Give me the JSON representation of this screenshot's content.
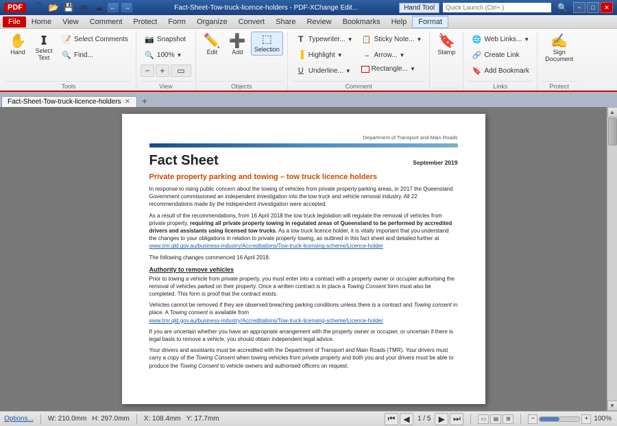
{
  "titlebar": {
    "title": "Fact-Sheet-Tow-truck-licence-holders - PDF-XChange Edit...",
    "tool": "Hand Tool",
    "search_placeholder": "Quick Launch (Ctrl+.)",
    "minimize": "−",
    "maximize": "□",
    "close": "✕"
  },
  "menubar": {
    "items": [
      "File",
      "Home",
      "View",
      "Comment",
      "Protect",
      "Form",
      "Organize",
      "Convert",
      "Share",
      "Review",
      "Bookmarks",
      "Help",
      "Format"
    ]
  },
  "ribbon": {
    "groups": [
      {
        "name": "Tools",
        "items_row1": [
          {
            "label": "Hand",
            "icon": "✋"
          },
          {
            "label": "Select\nText",
            "icon": "▌"
          },
          {
            "label": "Select\nComments",
            "icon": "📝"
          }
        ],
        "items_row2": [
          {
            "label": "Find...",
            "icon": "🔍"
          }
        ]
      },
      {
        "name": "View",
        "items": [
          {
            "label": "Snapshot",
            "icon": "📷"
          },
          {
            "label": "100%",
            "icon": ""
          },
          {
            "label": "View",
            "icon": ""
          }
        ]
      },
      {
        "name": "Objects",
        "items": [
          {
            "label": "Edit",
            "icon": "✏️"
          },
          {
            "label": "Add",
            "icon": "➕"
          },
          {
            "label": "Selection",
            "icon": "⬚"
          }
        ]
      },
      {
        "name": "Comment",
        "items": [
          {
            "label": "Typewriter...",
            "icon": "T"
          },
          {
            "label": "Highlight",
            "icon": "🖊"
          },
          {
            "label": "Underline...",
            "icon": "U"
          },
          {
            "label": "Sticky Note...",
            "icon": "📋"
          },
          {
            "label": "Arrow...",
            "icon": "→"
          },
          {
            "label": "Rectangle...",
            "icon": "□"
          }
        ]
      },
      {
        "name": "Stamp",
        "items": [
          {
            "label": "Stamp",
            "icon": "🔖"
          }
        ]
      },
      {
        "name": "Links",
        "items": [
          {
            "label": "Web Links...",
            "icon": "🔗"
          },
          {
            "label": "Create Link",
            "icon": "🔗"
          },
          {
            "label": "Add Bookmark",
            "icon": "🔖"
          }
        ]
      },
      {
        "name": "Protect",
        "items": [
          {
            "label": "Sign\nDocument",
            "icon": "🖊"
          }
        ]
      }
    ]
  },
  "doc_tab": {
    "name": "Fact-Sheet-Tow-truck-licence-holders",
    "close": "✕",
    "new_tab": "+"
  },
  "pdf": {
    "dept": "Department of Transport and Main Roads",
    "title": "Fact Sheet",
    "date": "September 2019",
    "subtitle": "Private property parking and towing – tow truck licence holders",
    "paragraphs": [
      "In response to rising public concern about the towing of vehicles from private property parking areas, in 2017 the Queensland Government commissioned an independent investigation into the tow truck and vehicle removal industry. All 22 recommendations made by the independent investigation were accepted.",
      "As a result of the recommendations, from 16 April 2018 the tow truck legislation will regulate the removal of vehicles from private property, requiring all private property towing in regulated areas of Queensland to be performed by accredited drivers and assistants using licensed tow trucks. As a tow truck licence holder, it is vitally important that you understand the changes to your obligations in relation to private property towing, as outlined in this fact sheet and detailed further at www.tmr.qld.gov.au/business-industry/Accreditations/Tow-truck-licensing-scheme/Licence-holder",
      "The following changes commenced 16 April 2018.",
      "Authority to remove vehicles",
      "Prior to towing a vehicle from private property, you must enter into a contract with a property owner or occupier authorising the removal of vehicles parked on their property. Once a written contract is in place a Towing Consent form must also be completed. This form is proof that the contract exists.",
      "Vehicles cannot be removed if they are observed breaching parking conditions unless there is a contract and Towing consent in place. A Towing consent is available from www.tmr.qld.gov.au/business-industry/Accreditations/Tow-truck-licensing-scheme/Licence-holder",
      "If you are uncertain whether you have an appropriate arrangement with the property owner or occupier, or uncertain if there is legal basis to remove a vehicle, you should obtain independent legal advice.",
      "Your drivers and assistants must be accredited with the Department of Transport and Main Roads (TMR). Your drivers must carry a copy of the Towing Consent when towing vehicles from private property and both you and your drivers must be able to produce the Towing Consent to vehicle owners and authorised officers on request."
    ]
  },
  "statusbar": {
    "options": "Options...",
    "width": "W: 210.0mm",
    "height": "H: 297.0mm",
    "x": "X: 108.4mm",
    "y": "Y: 17.7mm",
    "page": "1 / 5",
    "zoom": "100%",
    "nav_first": "⏮",
    "nav_prev": "◀",
    "nav_next": "▶",
    "nav_last": "⏭",
    "zoom_out": "−",
    "zoom_in": "+"
  }
}
